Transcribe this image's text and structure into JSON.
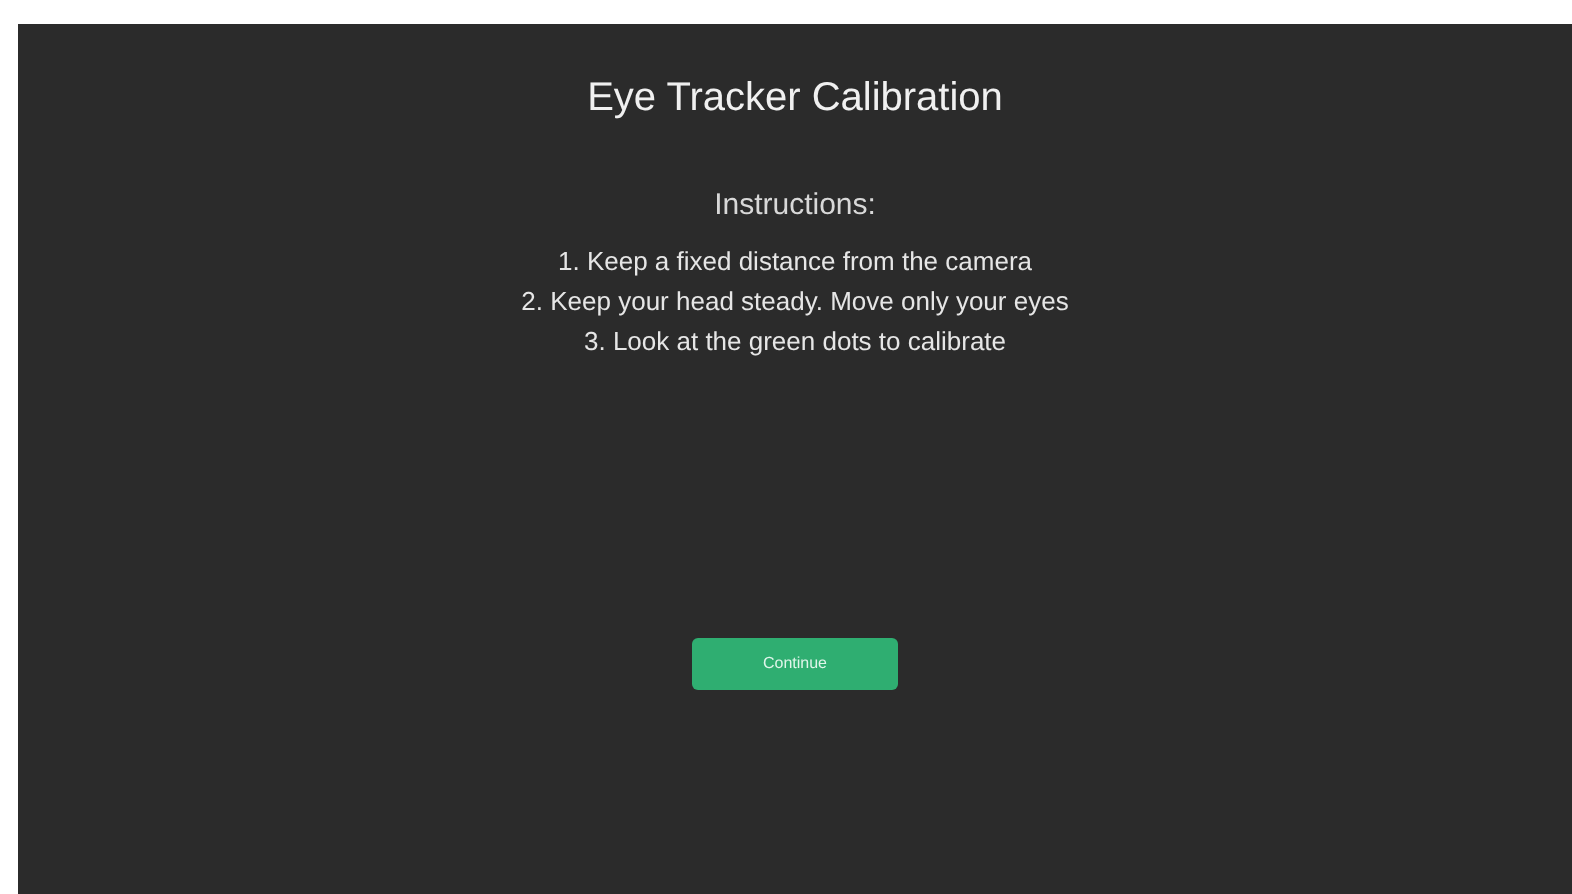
{
  "title": "Eye Tracker Calibration",
  "instructions": {
    "heading": "Instructions:",
    "steps": [
      "1. Keep a fixed distance from the camera",
      "2. Keep your head steady. Move only your eyes",
      "3. Look at the green dots to calibrate"
    ]
  },
  "button": {
    "label": "Continue"
  }
}
